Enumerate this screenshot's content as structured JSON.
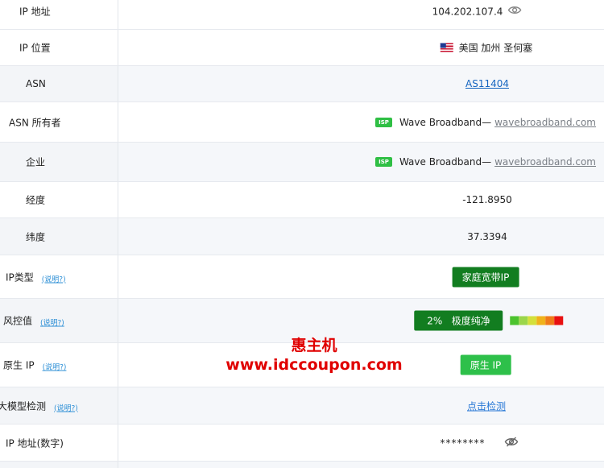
{
  "rows": {
    "ip": {
      "label": "IP 地址",
      "value": "104.202.107.4"
    },
    "location": {
      "label": "IP 位置",
      "value": "美国 加州 圣何塞"
    },
    "asn": {
      "label": "ASN",
      "value": "AS11404"
    },
    "asn_owner": {
      "label": "ASN 所有者",
      "badge": "ISP",
      "name": "Wave Broadband—",
      "link": "wavebroadband.com"
    },
    "company": {
      "label": "企业",
      "badge": "ISP",
      "name": "Wave Broadband—",
      "link": "wavebroadband.com"
    },
    "longitude": {
      "label": "经度",
      "value": "-121.8950"
    },
    "latitude": {
      "label": "纬度",
      "value": "37.3394"
    },
    "ip_type": {
      "label": "IP类型",
      "hint": "(说明?)",
      "value": "家庭宽带IP"
    },
    "risk": {
      "label": "风控值",
      "hint": "(说明?)",
      "value": "2%   极度纯净",
      "risk_percent": 2
    },
    "native": {
      "label": "原生 IP",
      "hint": "(说明?)",
      "value": "原生 IP"
    },
    "llm": {
      "label": "大模型检测",
      "hint": "(说明?)",
      "value": "点击检测"
    },
    "ip_numeric": {
      "label": "IP 地址(数字)",
      "value": "********"
    }
  },
  "watermark": {
    "line1": "惠主机",
    "line2": "www.idccoupon.com"
  },
  "colors": {
    "badge_dark": "#127d20",
    "badge_light": "#2ec04a",
    "isp_badge": "#2fbf44",
    "link": "#1565c0",
    "watermark": "#e00000",
    "risk_scale": [
      "#4cc32e",
      "#9bd64a",
      "#d4e03a",
      "#f0b21a",
      "#f07a18",
      "#e81010"
    ]
  },
  "icons": {
    "ip_eye": "eye-icon",
    "numeric_eye": "eye-off-icon",
    "flag": "us-flag-icon"
  }
}
